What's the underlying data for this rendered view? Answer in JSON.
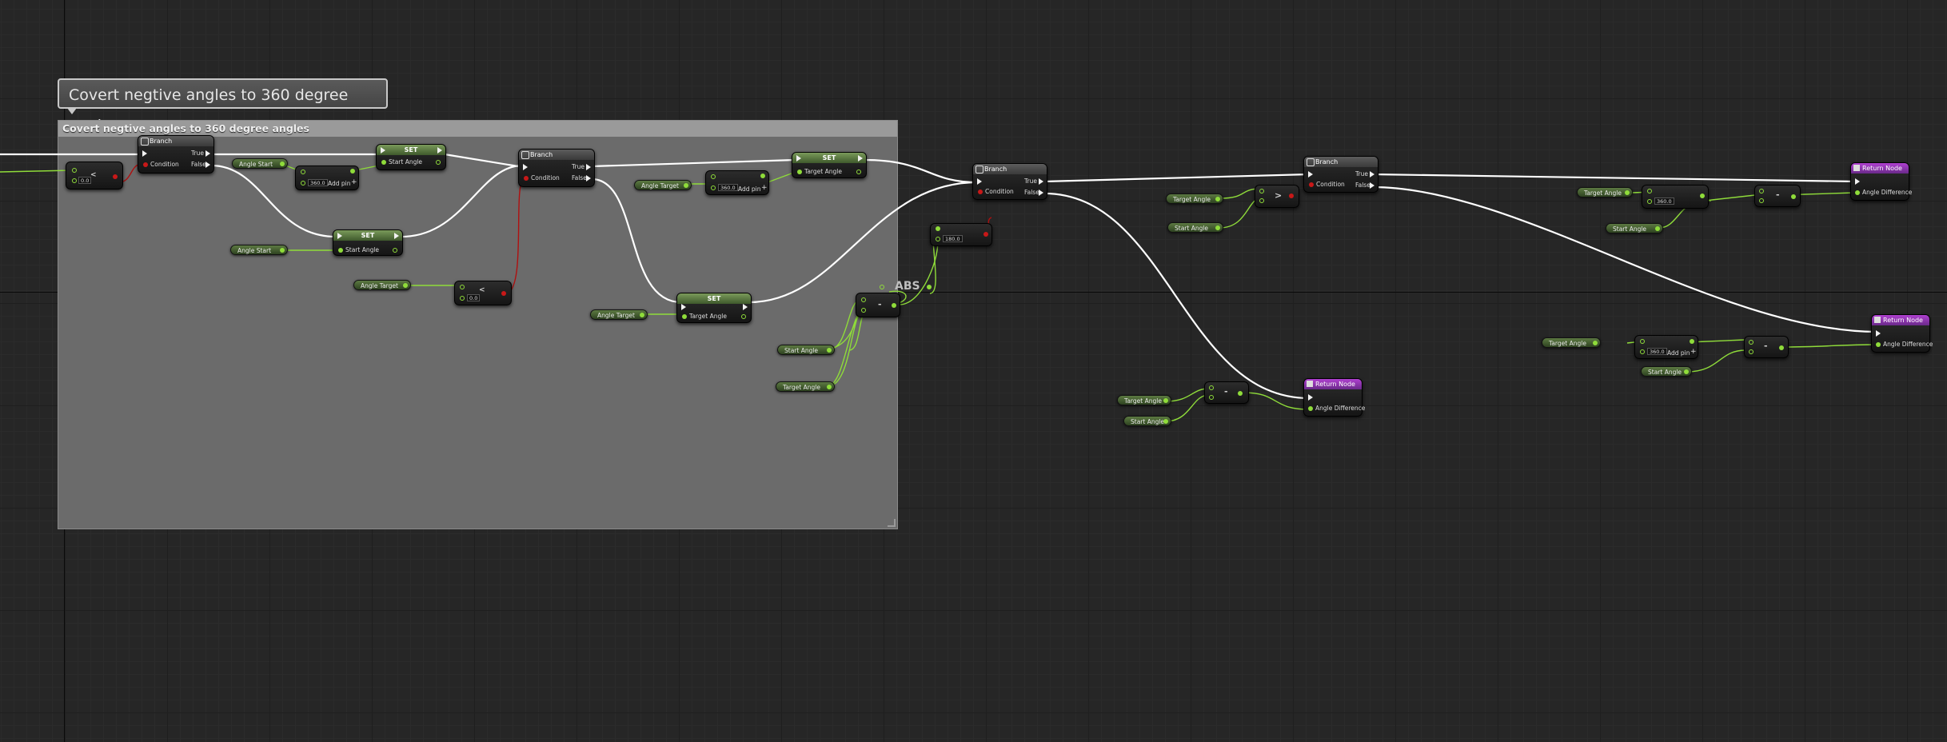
{
  "comment": {
    "bubble_text": "Covert negtive angles to 360 degree angles",
    "box_title": "Covert negtive angles to 360 degree angles"
  },
  "labels": {
    "branch": "Branch",
    "set": "SET",
    "return_node": "Return Node",
    "true": "True",
    "false": "False",
    "condition": "Condition",
    "start_angle": "Start Angle",
    "target_angle": "Target Angle",
    "angle_start": "Angle Start",
    "angle_target": "Angle Target",
    "angle_difference": "Angle Difference",
    "add_pin": "Add pin",
    "abs": "ABS",
    "minus": "-",
    "greater": ">",
    "less": "<"
  },
  "values": {
    "zero": "0.0",
    "v360": "360.0",
    "v180": "180.0"
  },
  "colors": {
    "exec_wire": "#ffffff",
    "float_wire": "#8fdc3a",
    "bool_wire": "#b01010",
    "return_header": "#a83bc8",
    "set_header": "#5a7a3c"
  },
  "icons": [
    "branch-icon",
    "function-icon"
  ]
}
